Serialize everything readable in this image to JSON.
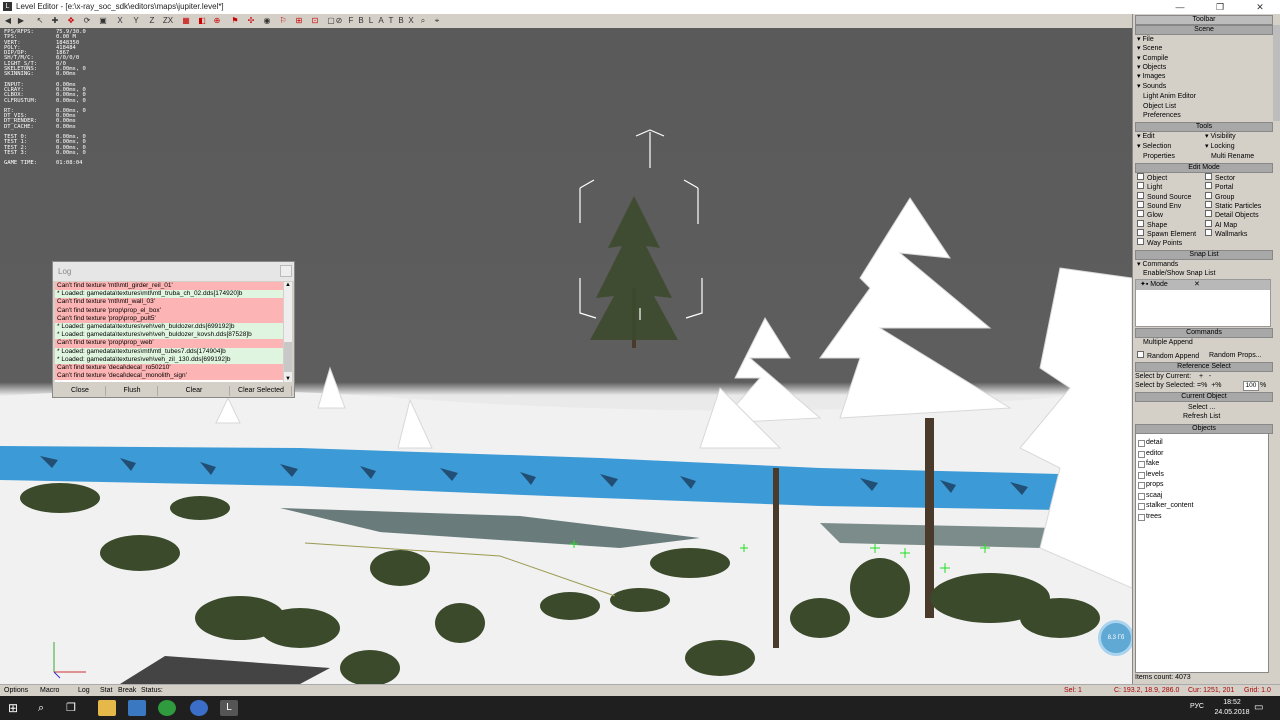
{
  "window": {
    "title": "Level Editor - [e:\\x-ray_soc_sdk\\editors\\maps\\jupiter.level*]",
    "minimize": "—",
    "maximize": "❐",
    "close": "✕"
  },
  "toolbar": {
    "letters": [
      "F",
      "B",
      "L",
      "A",
      "T",
      "B",
      "X"
    ],
    "axis_x": "X",
    "axis_y": "Y",
    "axis_z": "Z",
    "axis_zx": "ZX"
  },
  "stats": [
    {
      "k": "FPS/RFPS:",
      "v": "75.9/30.0"
    },
    {
      "k": "TPS:",
      "v": "0.00 M"
    },
    {
      "k": "VERT:",
      "v": "1848350"
    },
    {
      "k": "POLY:",
      "v": "418484"
    },
    {
      "k": "DIP/DP:",
      "v": "1867"
    },
    {
      "k": "SH/T/M/C:",
      "v": "0/0/0/0"
    },
    {
      "k": "LIGHT S/T:",
      "v": "0/0"
    },
    {
      "k": "SKELETONS:",
      "v": "0.00ms, 0"
    },
    {
      "k": "SKINNING:",
      "v": "0.00ms"
    },
    {
      "k": "",
      "v": ""
    },
    {
      "k": "INPUT:",
      "v": "0.00ms"
    },
    {
      "k": "CLRAY:",
      "v": "0.00ms, 0"
    },
    {
      "k": "CLBOX:",
      "v": "0.00ms, 0"
    },
    {
      "k": "CLFRUSTUM:",
      "v": "0.00ms, 0"
    },
    {
      "k": "",
      "v": ""
    },
    {
      "k": "RT:",
      "v": "0.00ms, 0"
    },
    {
      "k": "DT_VIS:",
      "v": "0.00ms"
    },
    {
      "k": "DT_RENDER:",
      "v": "0.00ms"
    },
    {
      "k": "DT_CACHE:",
      "v": "0.00ms"
    },
    {
      "k": "",
      "v": ""
    },
    {
      "k": "TEST 0:",
      "v": "0.00ms, 0"
    },
    {
      "k": "TEST 1:",
      "v": "0.00ms, 0"
    },
    {
      "k": "TEST 2:",
      "v": "0.00ms, 0"
    },
    {
      "k": "TEST 3:",
      "v": "0.00ms, 0"
    },
    {
      "k": "",
      "v": ""
    },
    {
      "k": "GAME TIME:",
      "v": "01:08:04"
    }
  ],
  "log": {
    "title": "Log",
    "rows": [
      {
        "t": "Can't find texture 'mtl\\mtl_girder_reil_01'",
        "kind": "err"
      },
      {
        "t": "* Loaded: gamedata\\textures\\mtl\\mtl_truba_ch_02.dds[174920]b",
        "kind": "ok"
      },
      {
        "t": "Can't find texture 'mtl\\mtl_wall_03'",
        "kind": "err"
      },
      {
        "t": "Can't find texture 'prop\\prop_el_box'",
        "kind": "err"
      },
      {
        "t": "Can't find texture 'prop\\prop_pult5'",
        "kind": "err"
      },
      {
        "t": "* Loaded: gamedata\\textures\\veh\\veh_buldozer.dds[699192]b",
        "kind": "ok"
      },
      {
        "t": "* Loaded: gamedata\\textures\\veh\\veh_buldozer_kovsh.dds[87528]b",
        "kind": "ok"
      },
      {
        "t": "Can't find texture 'prop\\prop_web'",
        "kind": "err"
      },
      {
        "t": "* Loaded: gamedata\\textures\\mtl\\mtl_tubes7.dds[174904]b",
        "kind": "ok"
      },
      {
        "t": "* Loaded: gamedata\\textures\\veh\\veh_zil_130.dds[699192]b",
        "kind": "ok"
      },
      {
        "t": "Can't find texture 'decal\\decal_ro50210'",
        "kind": "err"
      },
      {
        "t": "Can't find texture 'decal\\decal_monolith_sign'",
        "kind": "err"
      }
    ],
    "buttons": {
      "close": "Close",
      "flush": "Flush",
      "clear": "Clear",
      "clear_selected": "Clear Selected"
    }
  },
  "panel": {
    "header": "Toolbar",
    "scene_header": "Scene",
    "scene_items": [
      "File",
      "Scene",
      "Compile",
      "Objects",
      "Images",
      "Sounds"
    ],
    "scene_links": [
      "Light Anim Editor",
      "Object List",
      "Preferences"
    ],
    "tools_header": "Tools",
    "tools_left": [
      "Edit",
      "Selection"
    ],
    "tools_right": [
      "Visibility",
      "Locking"
    ],
    "properties": "Properties",
    "multi_rename": "Multi Rename",
    "edit_mode_header": "Edit Mode",
    "modes_left": [
      "Object",
      "Light",
      "Sound Source",
      "Sound Env",
      "Glow",
      "Shape",
      "Spawn Element",
      "Way Points"
    ],
    "modes_right": [
      "Sector",
      "Portal",
      "Group",
      "Static Particles",
      "Detail Objects",
      "AI Map",
      "Wallmarks"
    ],
    "snap_header": "Snap List",
    "snap_commands": "Commands",
    "snap_enable": "Enable/Show Snap List",
    "snap_mode": "Mode",
    "snap_x": "✕",
    "commands_header": "Commands",
    "multiple_append": "Multiple Append",
    "random_append": "Random Append",
    "random_props": "Random Props...",
    "ref_header": "Reference Select",
    "select_current": "Select by Current:",
    "select_selected": "Select by Selected:",
    "pct_value": "100",
    "current_header": "Current Object",
    "select_btn": "Select ...",
    "refresh_btn": "Refresh List",
    "objects_header": "Objects",
    "objects": [
      "detail",
      "editor",
      "fake",
      "levels",
      "props",
      "scaaj",
      "stalker_content",
      "trees"
    ],
    "items_count": "Items count: 4073"
  },
  "statusbar": {
    "options": "Options",
    "macro": "Macro",
    "log": "Log",
    "stat": "Stat",
    "break": "Break",
    "status": "Status:",
    "sel": "Sel: 1",
    "coords": "C: 193.2, 18.9, 286.0",
    "cur": "Cur: 1251, 201",
    "grid": "Grid: 1.0"
  },
  "taskbar": {
    "lang": "РУС",
    "time": "18:52",
    "date": "24.05.2018"
  },
  "badge": "8.3 Гб"
}
